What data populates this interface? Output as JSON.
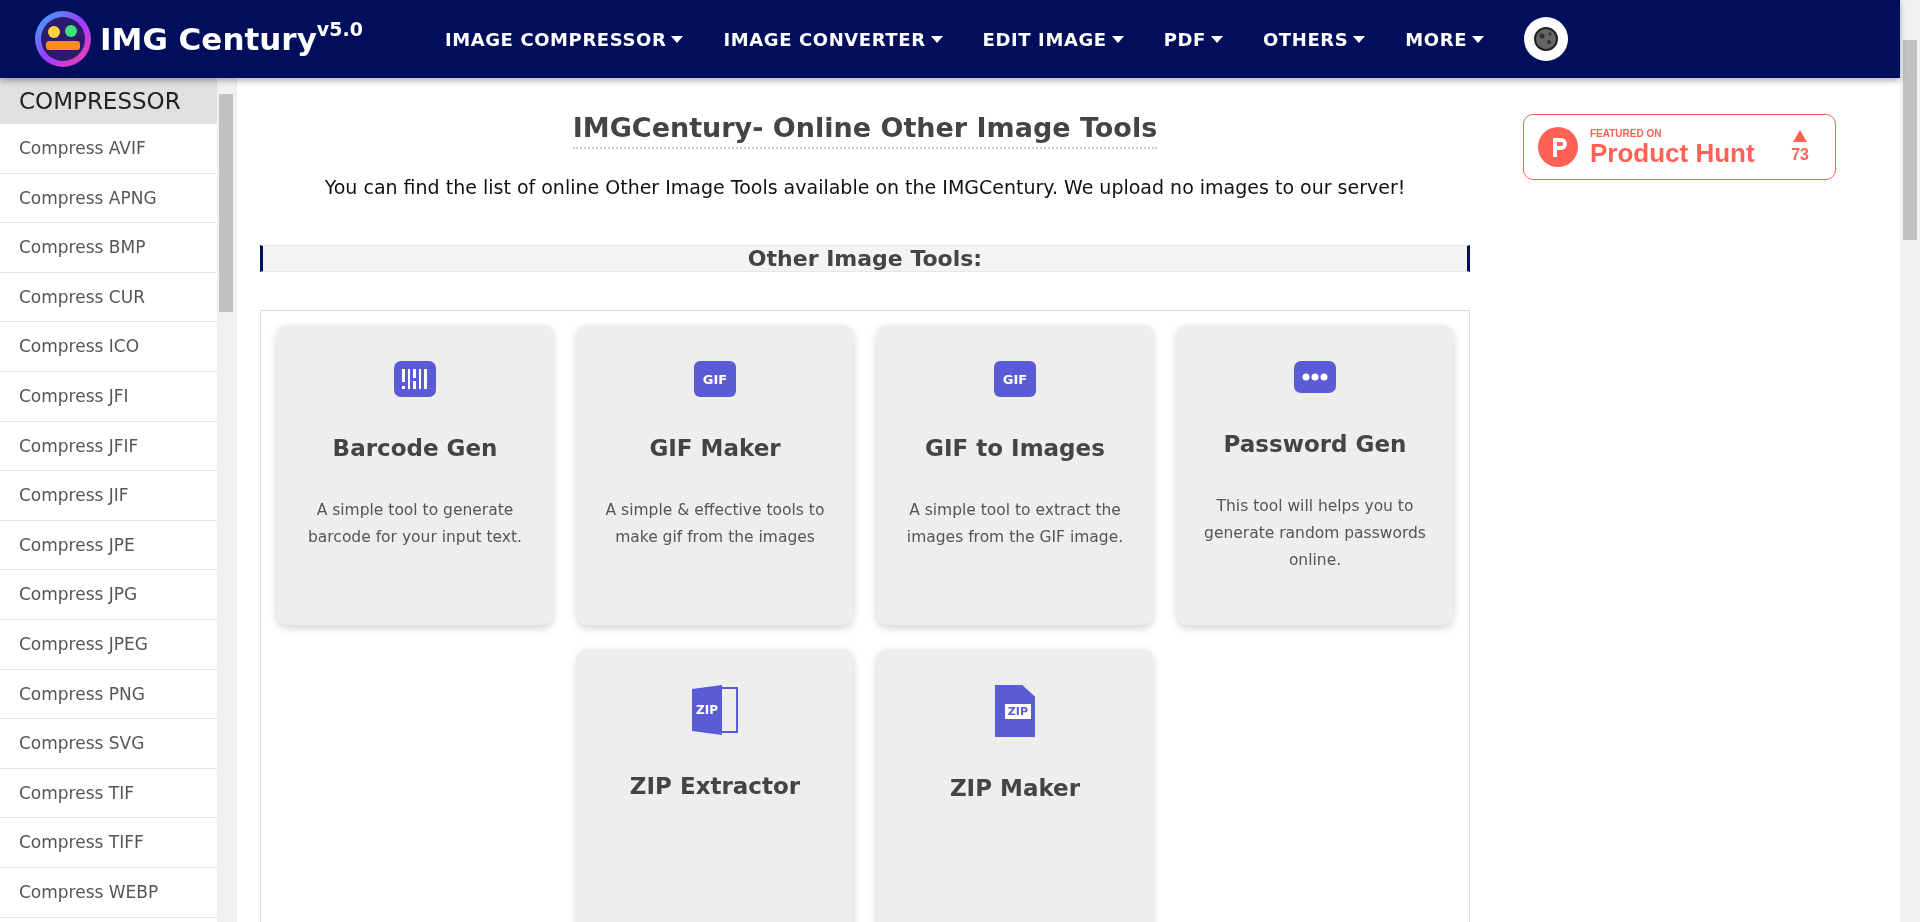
{
  "header": {
    "brand": "IMG Century",
    "version": "v5.0",
    "nav": [
      {
        "label": "IMAGE COMPRESSOR"
      },
      {
        "label": "IMAGE CONVERTER"
      },
      {
        "label": "EDIT IMAGE"
      },
      {
        "label": "PDF"
      },
      {
        "label": "OTHERS"
      },
      {
        "label": "MORE"
      }
    ]
  },
  "sidebar": {
    "heading": "COMPRESSOR",
    "items": [
      "Compress AVIF",
      "Compress APNG",
      "Compress BMP",
      "Compress CUR",
      "Compress ICO",
      "Compress JFI",
      "Compress JFIF",
      "Compress JIF",
      "Compress JPE",
      "Compress JPG",
      "Compress JPEG",
      "Compress PNG",
      "Compress SVG",
      "Compress TIF",
      "Compress TIFF",
      "Compress WEBP"
    ]
  },
  "main": {
    "title": "IMGCentury- Online Other Image Tools",
    "intro": "You can find the list of online Other Image Tools available on the IMGCentury. We upload no images to our server!",
    "section_heading": "Other Image Tools:",
    "cards": [
      {
        "kind": "barcode",
        "title": "Barcode Gen",
        "description": "A simple tool to generate barcode for your input text."
      },
      {
        "kind": "gif",
        "icon_text": "GIF",
        "title": "GIF Maker",
        "description": "A simple & effective tools to make gif from the images"
      },
      {
        "kind": "gif",
        "icon_text": "GIF",
        "title": "GIF to Images",
        "description": "A simple tool to extract the images from the GIF image."
      },
      {
        "kind": "password",
        "title": "Password Gen",
        "description": "This tool will helps you to generate random passwords online."
      },
      {
        "kind": "zip-open",
        "icon_text": "ZIP",
        "title": "ZIP Extractor"
      },
      {
        "kind": "zip-file",
        "icon_text": "ZIP",
        "title": "ZIP Maker"
      }
    ]
  },
  "badge": {
    "caption": "FEATURED ON",
    "name": "Product Hunt",
    "votes": "73"
  }
}
